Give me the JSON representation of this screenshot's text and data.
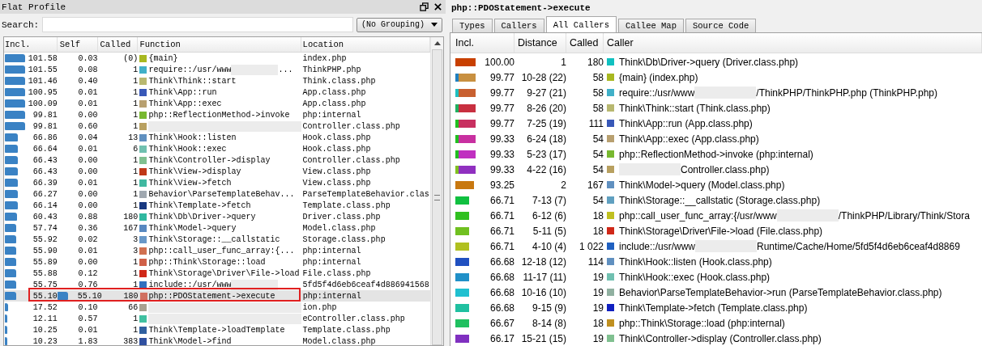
{
  "left_panel": {
    "title": "Flat Profile",
    "search": {
      "label": "Search:"
    },
    "grouping": "(No Grouping)",
    "table": {
      "columns": [
        "Incl.",
        "Self",
        "Called",
        "Function",
        "Location"
      ],
      "rows": [
        {
          "incl": "101.58",
          "self": "0.03",
          "called": "(0)",
          "color": "#a8b820",
          "function": "{main}",
          "location": "index.php",
          "selected": false
        },
        {
          "incl": "101.55",
          "self": "0.08",
          "called": "1",
          "color": "#40b0c8",
          "function": "require::/usr/www",
          "redacted": true,
          "function_rest": "...",
          "location": "ThinkPHP.php",
          "selected": false
        },
        {
          "incl": "101.46",
          "self": "0.40",
          "called": "1",
          "color": "#b8b870",
          "function": "Think\\Think::start",
          "location": "Think.class.php",
          "selected": false
        },
        {
          "incl": "100.95",
          "self": "0.01",
          "called": "1",
          "color": "#3858b8",
          "function": "Think\\App::run",
          "location": "App.class.php",
          "selected": false
        },
        {
          "incl": "100.09",
          "self": "0.01",
          "called": "1",
          "color": "#b8a070",
          "function": "Think\\App::exec",
          "location": "App.class.php",
          "selected": false
        },
        {
          "incl": "99.81",
          "self": "0.00",
          "called": "1",
          "color": "#78b830",
          "function": "php::ReflectionMethod->invoke",
          "location": "php:internal",
          "selected": false
        },
        {
          "incl": "99.81",
          "self": "0.60",
          "called": "1",
          "color": "#b8a060",
          "redacted": true,
          "location": "Controller.class.php",
          "selected": false
        },
        {
          "incl": "66.86",
          "self": "0.04",
          "called": "13",
          "color": "#6090c0",
          "function": "Think\\Hook::listen",
          "location": "Hook.class.php",
          "selected": false
        },
        {
          "incl": "66.64",
          "self": "0.01",
          "called": "6",
          "color": "#70c0b0",
          "function": "Think\\Hook::exec",
          "location": "Hook.class.php",
          "selected": false
        },
        {
          "incl": "66.43",
          "self": "0.00",
          "called": "1",
          "color": "#80c090",
          "function": "Think\\Controller->display",
          "location": "Controller.class.php",
          "selected": false
        },
        {
          "incl": "66.43",
          "self": "0.00",
          "called": "1",
          "color": "#c03818",
          "function": "Think\\View->display",
          "location": "View.class.php",
          "selected": false
        },
        {
          "incl": "66.39",
          "self": "0.01",
          "called": "1",
          "color": "#40b8a0",
          "function": "Think\\View->fetch",
          "location": "View.class.php",
          "selected": false
        },
        {
          "incl": "66.27",
          "self": "0.00",
          "called": "1",
          "color": "#a0a8b0",
          "function": "Behavior\\ParseTemplateBehav...",
          "location": "ParseTemplateBehavior.clas",
          "selected": false
        },
        {
          "incl": "66.14",
          "self": "0.00",
          "called": "1",
          "color": "#183880",
          "function": "Think\\Template->fetch",
          "location": "Template.class.php",
          "selected": false
        },
        {
          "incl": "60.43",
          "self": "0.88",
          "called": "180",
          "color": "#30b8a0",
          "function": "Think\\Db\\Driver->query",
          "location": "Driver.class.php",
          "selected": false
        },
        {
          "incl": "57.74",
          "self": "0.36",
          "called": "167",
          "color": "#5888c0",
          "function": "Think\\Model->query",
          "location": "Model.class.php",
          "selected": false
        },
        {
          "incl": "55.92",
          "self": "0.02",
          "called": "3",
          "color": "#6898c8",
          "function": "Think\\Storage::__callstatic",
          "location": "Storage.class.php",
          "selected": false
        },
        {
          "incl": "55.90",
          "self": "0.01",
          "called": "3",
          "color": "#d07050",
          "function": "php::call_user_func_array:{...",
          "location": "php:internal",
          "selected": false
        },
        {
          "incl": "55.89",
          "self": "0.00",
          "called": "1",
          "color": "#d06048",
          "function": "php::Think\\Storage::load",
          "location": "php:internal",
          "selected": false
        },
        {
          "incl": "55.88",
          "self": "0.12",
          "called": "1",
          "color": "#d02818",
          "function": "Think\\Storage\\Driver\\File->load",
          "location": "File.class.php",
          "selected": false
        },
        {
          "incl": "55.75",
          "self": "0.76",
          "called": "1",
          "color": "#3070c0",
          "function": "include::/usr/www",
          "redacted": true,
          "location": "5fd5f4d6eb6ceaf4d886941568",
          "selected": false
        },
        {
          "incl": "55.10",
          "self": "55.10",
          "self_bar": true,
          "called": "180",
          "color": "#d07060",
          "function": "php::PDOStatement->execute",
          "location": "php:internal",
          "selected": true
        },
        {
          "incl": "17.52",
          "self": "0.10",
          "called": "66",
          "color": "#a8a090",
          "redacted": true,
          "location": "ion.php",
          "selected": false
        },
        {
          "incl": "12.11",
          "self": "0.57",
          "called": "1",
          "color": "#40c0a0",
          "redacted": true,
          "location": "eController.class.php",
          "selected": false
        },
        {
          "incl": "10.25",
          "self": "0.01",
          "called": "1",
          "color": "#3060a0",
          "function": "Think\\Template->loadTemplate",
          "location": "Template.class.php",
          "selected": false
        },
        {
          "incl": "10.23",
          "self": "1.83",
          "called": "383",
          "color": "#3050a0",
          "function": "Think\\Model->find",
          "location": "Model.class.php",
          "selected": false
        }
      ]
    }
  },
  "right_panel": {
    "title": "php::PDOStatement->execute",
    "tabs": [
      {
        "label": "Types",
        "selected": false
      },
      {
        "label": "Callers",
        "selected": false
      },
      {
        "label": "All Callers",
        "selected": true
      },
      {
        "label": "Callee Map",
        "selected": false
      },
      {
        "label": "Source Code",
        "selected": false
      }
    ],
    "table": {
      "columns": [
        "Incl.",
        "Distance",
        "Called",
        "Caller"
      ],
      "rows": [
        {
          "bar": {
            "color": "#c84000"
          },
          "incl": "100.00",
          "distance": "1",
          "called": "180",
          "color": "#10c0c0",
          "caller": "Think\\Db\\Driver->query (Driver.class.php)"
        },
        {
          "bar": {
            "edge": {
              "color": "#2080c0"
            },
            "color": "#c89040"
          },
          "incl": "99.77",
          "distance": "10-28 (22)",
          "called": "58",
          "color": "#a8b820",
          "caller": "{main} (index.php)"
        },
        {
          "bar": {
            "edge": {
              "color": "#20c0c0"
            },
            "color": "#c86030"
          },
          "incl": "99.77",
          "distance": "9-27 (21)",
          "called": "58",
          "color": "#40b0c8",
          "caller": "require::/usr/www",
          "redacted": true,
          "caller_rest": "/ThinkPHP/ThinkPHP.php (ThinkPHP.php)"
        },
        {
          "bar": {
            "edge": {
              "color": "#20b060"
            },
            "color": "#c83040"
          },
          "incl": "99.77",
          "distance": "8-26 (20)",
          "called": "58",
          "color": "#b8b870",
          "caller": "Think\\Think::start (Think.class.php)"
        },
        {
          "bar": {
            "edge": {
              "color": "#20c020"
            },
            "color": "#c83060"
          },
          "incl": "99.77",
          "distance": "7-25 (19)",
          "called": "111",
          "color": "#3858b8",
          "caller": "Think\\App::run (App.class.php)"
        },
        {
          "bar": {
            "edge": {
              "color": "#20c020"
            },
            "color": "#c830a0"
          },
          "incl": "99.33",
          "distance": "6-24 (18)",
          "called": "54",
          "color": "#b8a070",
          "caller": "Think\\App::exec (App.class.php)"
        },
        {
          "bar": {
            "edge": {
              "color": "#20c020"
            },
            "color": "#c030c0"
          },
          "incl": "99.33",
          "distance": "5-23 (17)",
          "called": "54",
          "color": "#78b830",
          "caller": "php::ReflectionMethod->invoke (php:internal)"
        },
        {
          "bar": {
            "edge": {
              "color": "#80c020"
            },
            "color": "#9030c0"
          },
          "incl": "99.33",
          "distance": "4-22 (16)",
          "called": "54",
          "color": "#b8a060",
          "redacted": true,
          "caller_rest": "Controller.class.php)"
        },
        {
          "bar": {
            "color": "#c87810"
          },
          "incl": "93.25",
          "distance": "2",
          "called": "167",
          "color": "#6090c0",
          "caller": "Think\\Model->query (Model.class.php)"
        },
        {
          "bar": {
            "color": "#10c040"
          },
          "incl": "66.71",
          "distance": "7-13 (7)",
          "called": "54",
          "color": "#60a0c0",
          "caller": "Think\\Storage::__callstatic (Storage.class.php)"
        },
        {
          "bar": {
            "color": "#30c020"
          },
          "incl": "66.71",
          "distance": "6-12 (6)",
          "called": "18",
          "color": "#c0c020",
          "caller": "php::call_user_func_array:{/usr/www",
          "redacted": true,
          "caller_rest": "/ThinkPHP/Library/Think/Stora"
        },
        {
          "bar": {
            "color": "#70c020"
          },
          "incl": "66.71",
          "distance": "5-11 (5)",
          "called": "18",
          "color": "#d02818",
          "caller": "Think\\Storage\\Driver\\File->load (File.class.php)"
        },
        {
          "bar": {
            "color": "#b0c020"
          },
          "incl": "66.71",
          "distance": "4-10 (4)",
          "called": "1 022",
          "color": "#2060c0",
          "caller": "include::/usr/www",
          "redacted": true,
          "caller_rest": "Runtime/Cache/Home/5fd5f4d6eb6ceaf4d8869"
        },
        {
          "bar": {
            "color": "#2050c0"
          },
          "incl": "66.68",
          "distance": "12-18 (12)",
          "called": "114",
          "color": "#6090c0",
          "caller": "Think\\Hook::listen (Hook.class.php)"
        },
        {
          "bar": {
            "color": "#2090c8"
          },
          "incl": "66.68",
          "distance": "11-17 (11)",
          "called": "19",
          "color": "#70c0b0",
          "caller": "Think\\Hook::exec (Hook.class.php)"
        },
        {
          "bar": {
            "color": "#20c0d0"
          },
          "incl": "66.68",
          "distance": "10-16 (10)",
          "called": "19",
          "color": "#90b0a0",
          "caller": "Behavior\\ParseTemplateBehavior->run (ParseTemplateBehavior.class.php)"
        },
        {
          "bar": {
            "color": "#20c0a0"
          },
          "incl": "66.68",
          "distance": "9-15 (9)",
          "called": "19",
          "color": "#1020c0",
          "caller": "Think\\Template->fetch (Template.class.php)"
        },
        {
          "bar": {
            "color": "#20c060"
          },
          "incl": "66.67",
          "distance": "8-14 (8)",
          "called": "18",
          "color": "#c09020",
          "caller": "php::Think\\Storage::load (php:internal)"
        },
        {
          "bar": {
            "color": "#8030c0"
          },
          "incl": "66.17",
          "distance": "15-21 (15)",
          "called": "19",
          "color": "#80c090",
          "caller": "Think\\Controller->display (Controller.class.php)"
        }
      ]
    }
  }
}
